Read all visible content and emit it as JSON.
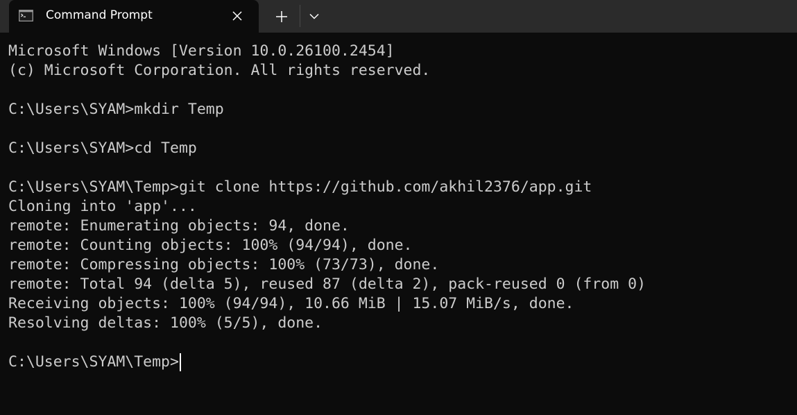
{
  "window": {
    "accent_colors": {
      "tabbar_bg": "#2b2b2b",
      "terminal_bg": "#0c0c0c",
      "terminal_fg": "#cccccc"
    }
  },
  "tab": {
    "title": "Command Prompt",
    "icon": "command-prompt-icon",
    "close_icon": "close-icon"
  },
  "tabbar": {
    "new_tab_icon": "plus-icon",
    "dropdown_icon": "chevron-down-icon"
  },
  "terminal": {
    "lines": [
      "Microsoft Windows [Version 10.0.26100.2454]",
      "(c) Microsoft Corporation. All rights reserved.",
      "",
      "C:\\Users\\SYAM>mkdir Temp",
      "",
      "C:\\Users\\SYAM>cd Temp",
      "",
      "C:\\Users\\SYAM\\Temp>git clone https://github.com/akhil2376/app.git",
      "Cloning into 'app'...",
      "remote: Enumerating objects: 94, done.",
      "remote: Counting objects: 100% (94/94), done.",
      "remote: Compressing objects: 100% (73/73), done.",
      "remote: Total 94 (delta 5), reused 87 (delta 2), pack-reused 0 (from 0)",
      "Receiving objects: 100% (94/94), 10.66 MiB | 15.07 MiB/s, done.",
      "Resolving deltas: 100% (5/5), done.",
      ""
    ],
    "prompt": "C:\\Users\\SYAM\\Temp>"
  }
}
